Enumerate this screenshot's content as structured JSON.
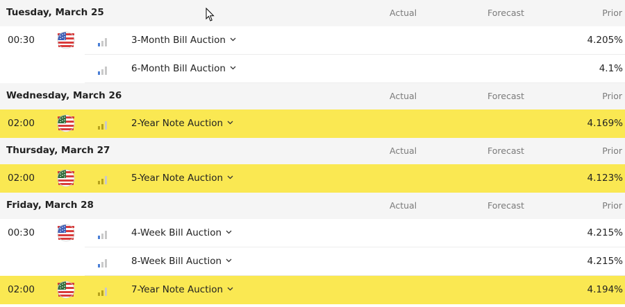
{
  "columns": {
    "actual": "Actual",
    "forecast": "Forecast",
    "prior": "Prior"
  },
  "days": [
    {
      "date": "Tuesday, March 25",
      "events": [
        {
          "time": "00:30",
          "name": "3-Month Bill Auction",
          "prior": "4.205%",
          "impact": "low",
          "highlighted": false,
          "show_flag": true
        },
        {
          "time": "",
          "name": "6-Month Bill Auction",
          "prior": "4.1%",
          "impact": "low",
          "highlighted": false,
          "show_flag": false
        }
      ]
    },
    {
      "date": "Wednesday, March 26",
      "events": [
        {
          "time": "02:00",
          "name": "2-Year Note Auction",
          "prior": "4.169%",
          "impact": "medium",
          "highlighted": true,
          "show_flag": true
        }
      ]
    },
    {
      "date": "Thursday, March 27",
      "events": [
        {
          "time": "02:00",
          "name": "5-Year Note Auction",
          "prior": "4.123%",
          "impact": "medium",
          "highlighted": true,
          "show_flag": true
        }
      ]
    },
    {
      "date": "Friday, March 28",
      "events": [
        {
          "time": "00:30",
          "name": "4-Week Bill Auction",
          "prior": "4.215%",
          "impact": "low",
          "highlighted": false,
          "show_flag": true
        },
        {
          "time": "",
          "name": "8-Week Bill Auction",
          "prior": "4.215%",
          "impact": "low",
          "highlighted": false,
          "show_flag": false
        },
        {
          "time": "02:00",
          "name": "7-Year Note Auction",
          "prior": "4.194%",
          "impact": "medium",
          "highlighted": true,
          "show_flag": true
        }
      ]
    }
  ],
  "colors": {
    "highlight": "#fae852",
    "header_bg": "#f5f5f5",
    "impact_low": "#4a7fd6",
    "impact_medium": "#b6a21c"
  },
  "icons": {
    "flag": "us-flag-icon",
    "impact": "impact-bars-icon",
    "expand": "chevron-down-icon",
    "cursor": "mouse-cursor-icon"
  }
}
